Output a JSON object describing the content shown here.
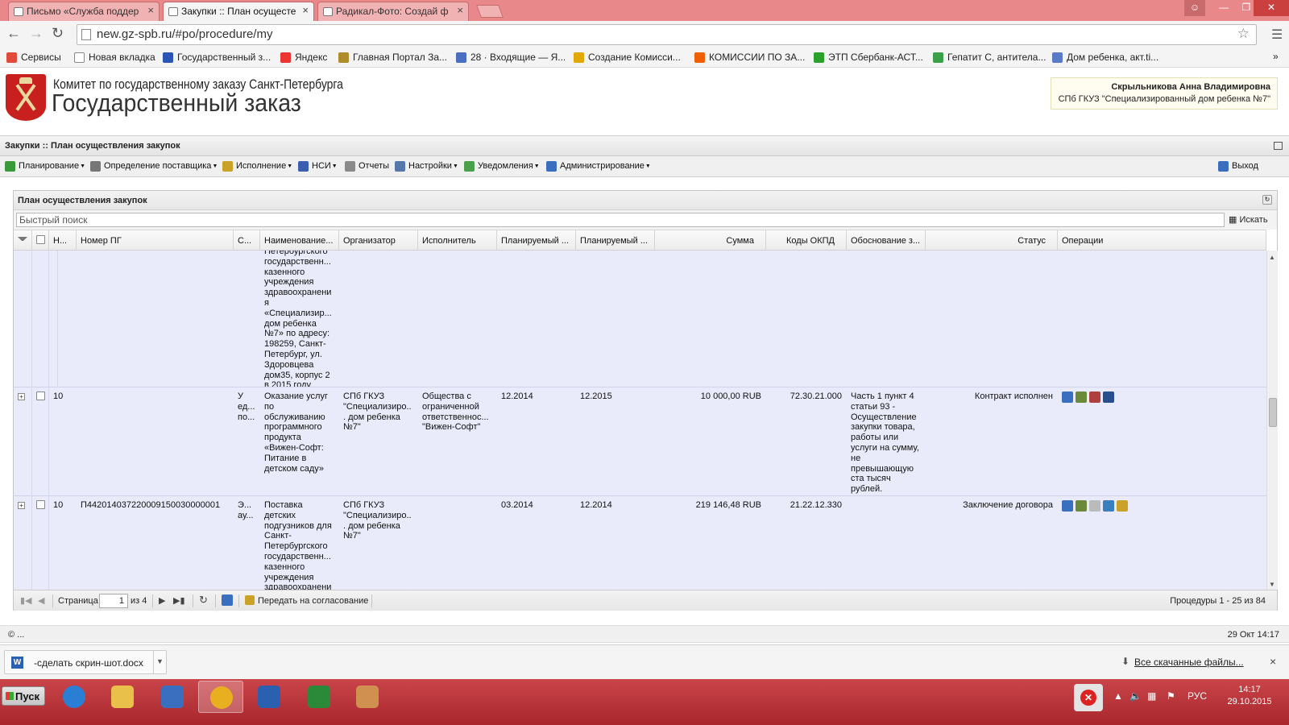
{
  "browser": {
    "tabs": [
      {
        "label": "Письмо «Служба поддер",
        "active": false
      },
      {
        "label": "Закупки :: План осущесте",
        "active": true
      },
      {
        "label": "Радикал-Фото: Создай ф",
        "active": false
      }
    ],
    "close_glyph": "×",
    "url": "new.gz-spb.ru/#po/procedure/my",
    "bookmarks": [
      {
        "label": "Сервисы",
        "color": "#e14b3b"
      },
      {
        "label": "Новая вкладка",
        "color": "#ffffff"
      },
      {
        "label": "Государственный з...",
        "color": "#2a55b5"
      },
      {
        "label": "Яндекс",
        "color": "#e33"
      },
      {
        "label": "Главная Портал За...",
        "color": "#b08b2a"
      },
      {
        "label": "28 · Входящие — Я...",
        "color": "#4a6fc0"
      },
      {
        "label": "Создание Комисси...",
        "color": "#e0a800"
      },
      {
        "label": "КОМИССИИ ПО ЗА...",
        "color": "#f06000"
      },
      {
        "label": "ЭТП Сбербанк-АСТ...",
        "color": "#2aa12a"
      },
      {
        "label": "Гепатит С, антитела...",
        "color": "#3aa04a"
      },
      {
        "label": "Дом ребенка, акт.ti...",
        "color": "#5a7ac8"
      }
    ],
    "bookmarks_more": "»"
  },
  "header": {
    "org_line1": "Комитет по государственному заказу Санкт-Петербурга",
    "org_line2": "Государственный заказ",
    "user_name": "Скрыльникова Анна Владимировна",
    "user_org": "СПб ГКУЗ \"Специализированный дом ребенка №7\""
  },
  "page": {
    "title": "Закупки :: План осуществления закупок"
  },
  "menu": {
    "items": [
      {
        "label": "Планирование",
        "color": "#3a9a3a"
      },
      {
        "label": "Определение поставщика",
        "color": "#777777"
      },
      {
        "label": "Исполнение",
        "color": "#c9a227"
      },
      {
        "label": "НСИ",
        "color": "#3a5fb0"
      },
      {
        "label": "Отчеты",
        "color": "#8a8a8a"
      },
      {
        "label": "Настройки",
        "color": "#5577aa"
      },
      {
        "label": "Уведомления",
        "color": "#4aa04a"
      },
      {
        "label": "Администрирование",
        "color": "#3a6fc0"
      }
    ],
    "exit_label": "Выход"
  },
  "panel": {
    "title": "План осуществления закупок",
    "search_placeholder": "Быстрый поиск",
    "search_button": "Искать",
    "columns": {
      "n": "Н...",
      "number": "Номер ПГ",
      "s": "С...",
      "name": "Наименование...",
      "organizer": "Организатор",
      "executor": "Исполнитель",
      "plan1": "Планируемый ...",
      "plan2": "Планируемый ...",
      "sum": "Сумма",
      "okpd": "Коды ОКПД",
      "reason": "Обоснование з...",
      "status": "Статус",
      "ops": "Операции"
    },
    "rows": [
      {
        "n": "",
        "number": "",
        "s": "",
        "name": "Петербургского государственн... казенного учреждения здравоохранения «Специализир... дом ребенка №7» по адресу: 198259, Санкт-Петербург, ул. Здоровцева дом35, корпус 2 в 2015 году",
        "organizer": "",
        "executor": "",
        "plan1": "",
        "plan2": "",
        "sum": "",
        "okpd": "",
        "reason": "",
        "status": "",
        "ops": []
      },
      {
        "n": "10",
        "number": "",
        "s": "У ед... по...",
        "name": "Оказание услуг по обслуживанию программного продукта «Вижен-Софт: Питание в детском саду»",
        "organizer": "СПб ГКУЗ \"Специализиро... дом ребенка №7\"",
        "executor": "Общества с ограниченной ответственнос... \"Вижен-Софт\"",
        "plan1": "12.2014",
        "plan2": "12.2015",
        "sum": "10 000,00 RUB",
        "okpd": "72.30.21.000",
        "reason": "Часть 1 пункт 4 статьи 93 - Осуществление закупки товара, работы или услуги на сумму, не превышающую ста тысяч рублей.",
        "status": "Контракт исполнен",
        "ops": [
          "#3a6fc0",
          "#6a8a3a",
          "#b04040",
          "#2a4f90"
        ]
      },
      {
        "n": "10",
        "number": "П442014037220009150030000001",
        "s": "Э... ау...",
        "name": "Поставка детских подгузников для Санкт-Петербургского государственн... казенного учреждения здравоохранения",
        "organizer": "СПб ГКУЗ \"Специализиро... дом ребенка №7\"",
        "executor": "",
        "plan1": "03.2014",
        "plan2": "12.2014",
        "sum": "219 146,48 RUB",
        "okpd": "21.22.12.330",
        "reason": "",
        "status": "Заключение договора",
        "ops": [
          "#3a6fc0",
          "#6a8a3a",
          "#bbbbbb",
          "#3a7fc0",
          "#c9a227"
        ]
      }
    ],
    "pager": {
      "page_label": "Страница",
      "page_value": "1",
      "of_label": "из 4",
      "send_label": "Передать на согласование",
      "summary": "Процедуры 1 - 25 из 84"
    }
  },
  "status": {
    "left": "© ...",
    "datetime": "29 Окт 14:17"
  },
  "downloads": {
    "file_label": "-сделать скрин-шот.docx",
    "all_label": "Все скачанные файлы...",
    "close_glyph": "×"
  },
  "taskbar": {
    "start_label": "Пуск",
    "apps": [
      {
        "name": "ie",
        "color": "#2a7fd4",
        "active": false
      },
      {
        "name": "explorer",
        "color": "#e8c04a",
        "active": false
      },
      {
        "name": "app3",
        "color": "#3a6fc0",
        "active": false
      },
      {
        "name": "chrome",
        "color": "#e8b020",
        "active": true
      },
      {
        "name": "word",
        "color": "#2b5fb0",
        "active": false
      },
      {
        "name": "excel",
        "color": "#2a8a3a",
        "active": false
      },
      {
        "name": "paint",
        "color": "#d09050",
        "active": false
      }
    ],
    "lang": "РУС",
    "time": "14:17",
    "date": "29.10.2015"
  }
}
